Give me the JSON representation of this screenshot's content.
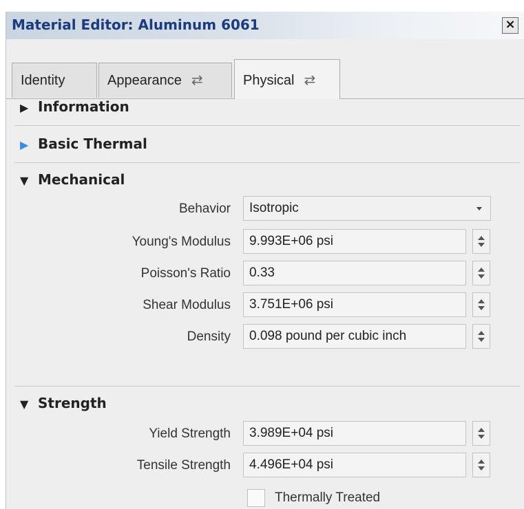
{
  "window": {
    "title": "Material Editor: Aluminum 6061",
    "close_label": "×"
  },
  "tabs": [
    {
      "label": "Identity"
    },
    {
      "label": "Appearance",
      "icon": "swap-icon"
    },
    {
      "label": "Physical",
      "icon": "swap-icon",
      "active": true
    }
  ],
  "sections": {
    "information": {
      "title": "Information",
      "expanded": false
    },
    "basic_thermal": {
      "title": "Basic Thermal",
      "expanded": false,
      "arrow_color": "#3b8de0"
    },
    "mechanical": {
      "title": "Mechanical",
      "expanded": true,
      "behavior": {
        "label": "Behavior",
        "value": "Isotropic"
      },
      "youngs_modulus": {
        "label": "Young's Modulus",
        "value": "9.993E+06 psi"
      },
      "poissons_ratio": {
        "label": "Poisson's Ratio",
        "value": "0.33"
      },
      "shear_modulus": {
        "label": "Shear Modulus",
        "value": "3.751E+06 psi"
      },
      "density": {
        "label": "Density",
        "value": "0.098 pound per cubic inch"
      }
    },
    "strength": {
      "title": "Strength",
      "expanded": true,
      "yield_strength": {
        "label": "Yield Strength",
        "value": "3.989E+04 psi"
      },
      "tensile_strength": {
        "label": "Tensile Strength",
        "value": "4.496E+04 psi"
      },
      "thermally_treated": {
        "label": "Thermally Treated",
        "checked": false
      }
    }
  },
  "colors": {
    "title_text": "#1b3b7d",
    "panel_bg": "#eeeeee"
  }
}
